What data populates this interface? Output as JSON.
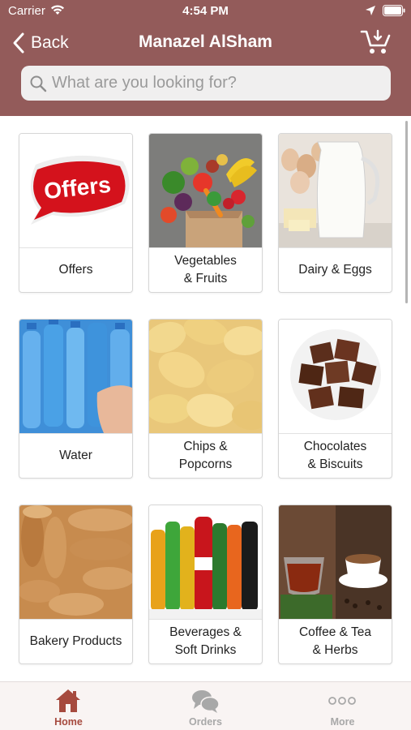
{
  "status_bar": {
    "carrier": "Carrier",
    "time": "4:54 PM"
  },
  "nav": {
    "back_label": "Back",
    "title": "Manazel AlSham"
  },
  "search": {
    "placeholder": "What are you looking for?"
  },
  "categories": [
    {
      "label": "Offers",
      "badge": "Offers"
    },
    {
      "label": "Vegetables\n& Fruits"
    },
    {
      "label": "Dairy & Eggs"
    },
    {
      "label": "Water"
    },
    {
      "label": "Chips &\nPopcorns"
    },
    {
      "label": "Chocolates\n& Biscuits"
    },
    {
      "label": "Bakery Products"
    },
    {
      "label": "Beverages &\nSoft Drinks"
    },
    {
      "label": "Coffee & Tea\n& Herbs"
    }
  ],
  "tabs": [
    {
      "label": "Home",
      "icon": "home-icon",
      "active": true
    },
    {
      "label": "Orders",
      "icon": "orders-icon",
      "active": false
    },
    {
      "label": "More",
      "icon": "more-icon",
      "active": false
    }
  ],
  "colors": {
    "header": "#935B5A",
    "active_tab": "#a64a3e",
    "inactive_tab": "#a8a8a8"
  }
}
